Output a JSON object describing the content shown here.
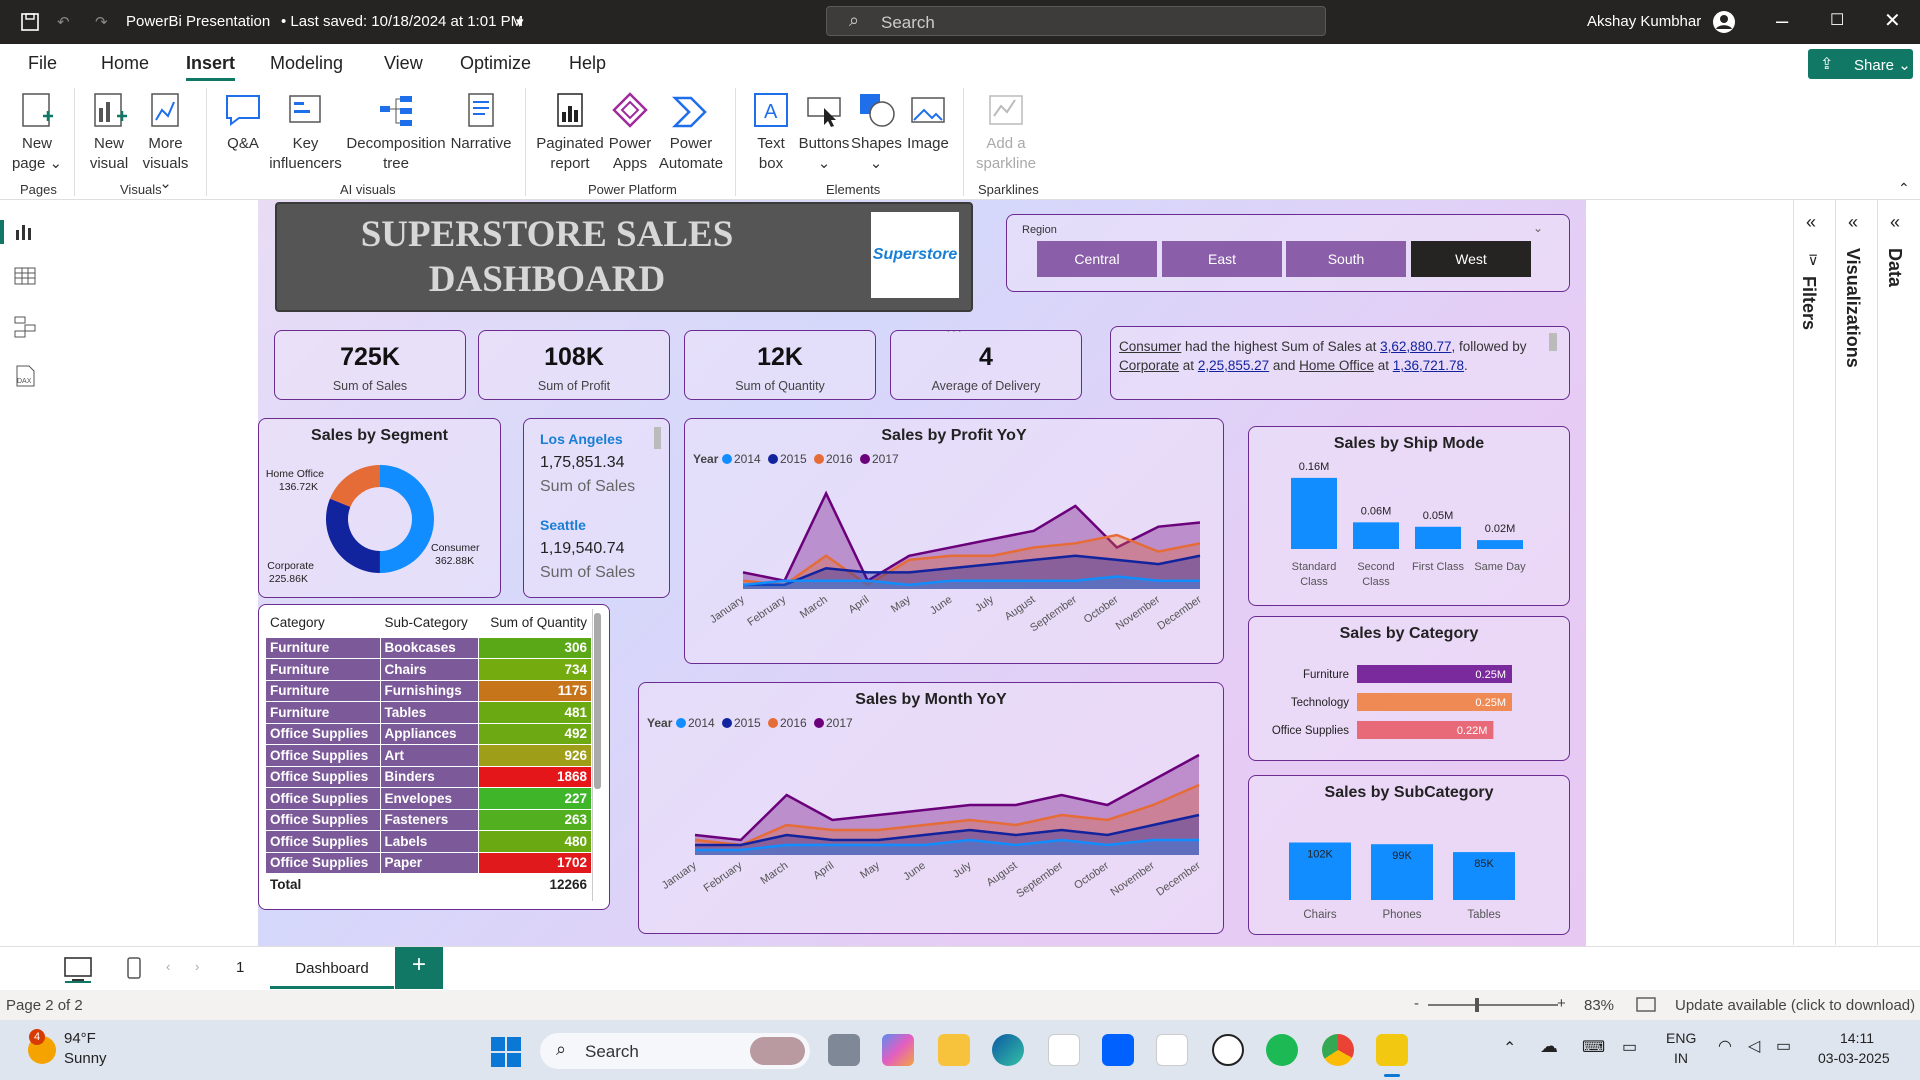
{
  "titlebar": {
    "file_title": "PowerBi Presentation",
    "saved": "• Last saved: 10/18/2024 at 1:01 PM",
    "search_placeholder": "Search",
    "user": "Akshay Kumbhar"
  },
  "menu": {
    "items": [
      "File",
      "Home",
      "Insert",
      "Modeling",
      "View",
      "Optimize",
      "Help"
    ],
    "active": "Insert",
    "share": "Share"
  },
  "ribbon": {
    "buttons": [
      {
        "l1": "New",
        "l2": "page ⌄"
      },
      {
        "l1": "New",
        "l2": "visual"
      },
      {
        "l1": "More",
        "l2": "visuals ⌄"
      },
      {
        "l1": "Q&A",
        "l2": ""
      },
      {
        "l1": "Key",
        "l2": "influencers"
      },
      {
        "l1": "Decomposition",
        "l2": "tree"
      },
      {
        "l1": "Narrative",
        "l2": ""
      },
      {
        "l1": "Paginated",
        "l2": "report"
      },
      {
        "l1": "Power",
        "l2": "Apps"
      },
      {
        "l1": "Power",
        "l2": "Automate"
      },
      {
        "l1": "Text",
        "l2": "box"
      },
      {
        "l1": "Buttons",
        "l2": "⌄"
      },
      {
        "l1": "Shapes",
        "l2": "⌄"
      },
      {
        "l1": "Image",
        "l2": ""
      },
      {
        "l1": "Add a",
        "l2": "sparkline"
      }
    ],
    "groups": [
      "Pages",
      "Visuals",
      "AI visuals",
      "Power Platform",
      "Elements",
      "Sparklines"
    ]
  },
  "dashboard": {
    "title_line1": "SUPERSTORE SALES",
    "title_line2": "DASHBOARD",
    "logo_text": "Superstore",
    "region": {
      "label": "Region",
      "options": [
        "Central",
        "East",
        "South",
        "West"
      ],
      "selected": "West"
    },
    "kpis": [
      {
        "value": "725K",
        "label": "Sum of Sales"
      },
      {
        "value": "108K",
        "label": "Sum of Profit"
      },
      {
        "value": "12K",
        "label": "Sum of Quantity"
      },
      {
        "value": "4",
        "label": "Average of Delivery"
      }
    ],
    "narrative": {
      "s1": "Consumer",
      "s2": " had the highest Sum of Sales at ",
      "s3": "3,62,880.77",
      "s4": ", followed by ",
      "s5": "Corporate",
      "s6": " at ",
      "s7": "2,25,855.27",
      "s8": " and ",
      "s9": "Home Office",
      "s10": " at ",
      "s11": "1,36,721.78",
      "s12": "."
    },
    "cities": [
      {
        "name": "Los Angeles",
        "value": "1,75,851.34",
        "label": "Sum of Sales"
      },
      {
        "name": "Seattle",
        "value": "1,19,540.74",
        "label": "Sum of Sales"
      }
    ],
    "table": {
      "headers": [
        "Category",
        "Sub-Category",
        "Sum of Quantity"
      ],
      "rows": [
        [
          "Furniture",
          "Bookcases",
          "306"
        ],
        [
          "Furniture",
          "Chairs",
          "734"
        ],
        [
          "Furniture",
          "Furnishings",
          "1175"
        ],
        [
          "Furniture",
          "Tables",
          "481"
        ],
        [
          "Office Supplies",
          "Appliances",
          "492"
        ],
        [
          "Office Supplies",
          "Art",
          "926"
        ],
        [
          "Office Supplies",
          "Binders",
          "1868"
        ],
        [
          "Office Supplies",
          "Envelopes",
          "227"
        ],
        [
          "Office Supplies",
          "Fasteners",
          "263"
        ],
        [
          "Office Supplies",
          "Labels",
          "480"
        ],
        [
          "Office Supplies",
          "Paper",
          "1702"
        ]
      ],
      "total": [
        "Total",
        "",
        "12266"
      ],
      "qty_colors": [
        "#5aa818",
        "#74ac10",
        "#c7751a",
        "#6aa912",
        "#6da913",
        "#9e9e18",
        "#e5161a",
        "#3fb52a",
        "#52b020",
        "#6ba913",
        "#e01a1c"
      ]
    }
  },
  "chart_data": [
    {
      "type": "pie",
      "title": "Sales by Segment",
      "labels": [
        "Consumer",
        "Corporate",
        "Home Office"
      ],
      "values": [
        362.88,
        225.86,
        136.72
      ],
      "data_labels": [
        "362.88K",
        "225.86K",
        "136.72K"
      ],
      "colors": [
        "#118dff",
        "#12239e",
        "#e66c37"
      ]
    },
    {
      "type": "area",
      "title": "Sales by Profit YoY",
      "legend_title": "Year",
      "categories": [
        "January",
        "February",
        "March",
        "April",
        "May",
        "June",
        "July",
        "August",
        "September",
        "October",
        "November",
        "December"
      ],
      "series": [
        {
          "name": "2014",
          "color": "#118dff",
          "values": [
            1,
            2,
            2,
            2,
            1,
            2,
            2,
            2,
            2,
            3,
            2,
            2
          ]
        },
        {
          "name": "2015",
          "color": "#12239e",
          "values": [
            1,
            1,
            5,
            4,
            4,
            5,
            6,
            7,
            8,
            7,
            6,
            8
          ]
        },
        {
          "name": "2016",
          "color": "#e66c37",
          "values": [
            2,
            1,
            8,
            1,
            7,
            8,
            8,
            10,
            11,
            13,
            9,
            11
          ]
        },
        {
          "name": "2017",
          "color": "#6b007b",
          "values": [
            4,
            2,
            23,
            2,
            8,
            10,
            12,
            14,
            20,
            10,
            15,
            16
          ]
        }
      ],
      "ylim": [
        0,
        26
      ]
    },
    {
      "type": "area",
      "title": "Sales by Month YoY",
      "legend_title": "Year",
      "categories": [
        "January",
        "February",
        "March",
        "April",
        "May",
        "June",
        "July",
        "August",
        "September",
        "October",
        "November",
        "December"
      ],
      "series": [
        {
          "name": "2014",
          "color": "#118dff",
          "values": [
            1,
            1,
            2,
            2,
            2,
            2,
            3,
            2,
            3,
            2,
            3,
            3
          ]
        },
        {
          "name": "2015",
          "color": "#12239e",
          "values": [
            2,
            2,
            4,
            3,
            3,
            4,
            5,
            4,
            5,
            4,
            6,
            8
          ]
        },
        {
          "name": "2016",
          "color": "#e66c37",
          "values": [
            3,
            2,
            6,
            5,
            5,
            6,
            7,
            6,
            8,
            7,
            10,
            14
          ]
        },
        {
          "name": "2017",
          "color": "#6b007b",
          "values": [
            4,
            3,
            12,
            7,
            8,
            9,
            10,
            10,
            12,
            10,
            15,
            20
          ]
        }
      ],
      "ylim": [
        0,
        22
      ]
    },
    {
      "type": "bar",
      "title": "Sales by Ship Mode",
      "categories": [
        "Standard Class",
        "Second Class",
        "First Class",
        "Same Day"
      ],
      "values": [
        0.16,
        0.06,
        0.05,
        0.02
      ],
      "data_labels": [
        "0.16M",
        "0.06M",
        "0.05M",
        "0.02M"
      ],
      "ylim": [
        0,
        0.18
      ],
      "color": "#118dff"
    },
    {
      "type": "bar",
      "orientation": "horizontal",
      "title": "Sales by Category",
      "categories": [
        "Furniture",
        "Technology",
        "Office Supplies"
      ],
      "values": [
        0.25,
        0.25,
        0.22
      ],
      "data_labels": [
        "0.25M",
        "0.25M",
        "0.22M"
      ],
      "colors": [
        "#7b2a9e",
        "#f08a55",
        "#e86a78"
      ],
      "xlim": [
        0,
        0.25
      ]
    },
    {
      "type": "bar",
      "title": "Sales by SubCategory",
      "categories": [
        "Chairs",
        "Phones",
        "Tables"
      ],
      "values": [
        102,
        99,
        85
      ],
      "data_labels": [
        "102K",
        "99K",
        "85K"
      ],
      "ylim": [
        0,
        110
      ],
      "color": "#118dff"
    }
  ],
  "rightpanes": [
    "Filters",
    "Visualizations",
    "Data"
  ],
  "pages": {
    "page_num": "1",
    "tab": "Dashboard",
    "status": "Page 2 of 2",
    "zoom": "83%",
    "update": "Update available (click to download)"
  },
  "taskbar": {
    "temp": "94°F",
    "weather": "Sunny",
    "badge": "4",
    "search": "Search",
    "lang1": "ENG",
    "lang2": "IN",
    "time": "14:11",
    "date": "03-03-2025"
  }
}
